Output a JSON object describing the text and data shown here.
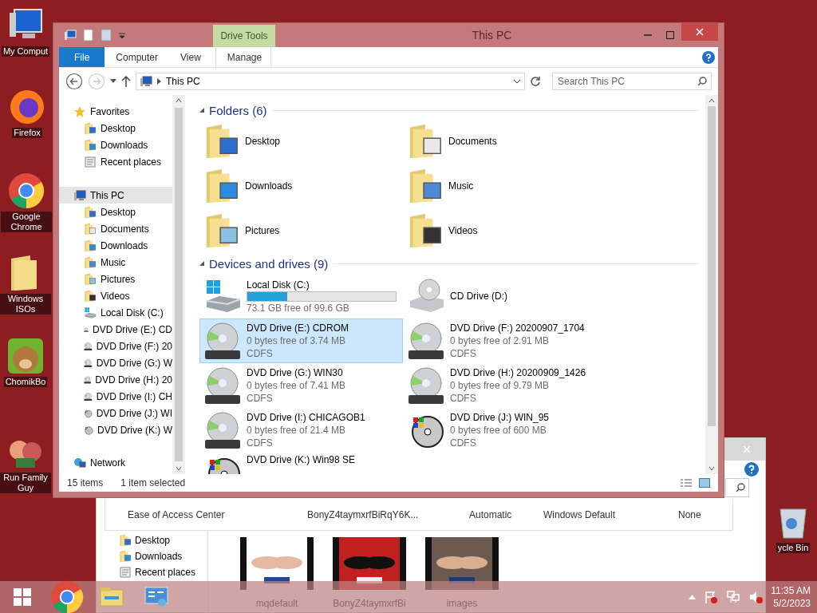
{
  "desktop_icons": [
    {
      "label": "My Comput",
      "kind": "computer"
    },
    {
      "label": "Firefox",
      "kind": "firefox"
    },
    {
      "label": "Google Chrome",
      "kind": "chrome"
    },
    {
      "label": "Windows ISOs",
      "kind": "folder"
    },
    {
      "label": "ChomikBo",
      "kind": "mascot"
    },
    {
      "label": "Run Family Guy",
      "kind": "cartoon"
    },
    {
      "label": "ycle Bin",
      "kind": "bin"
    }
  ],
  "background_window": {
    "row": {
      "name": "Ease of Access Center",
      "cells": [
        "BonyZ4taymxrfBiRqY6K...",
        "Automatic",
        "Windows Default",
        "None"
      ]
    },
    "sidebar": [
      "Desktop",
      "Downloads",
      "Recent places"
    ],
    "thumbnails": [
      {
        "label": "mqdefault",
        "kind": "picture"
      },
      {
        "label": "BonyZ4taymxrfBi",
        "kind": "picture"
      },
      {
        "label": "images",
        "kind": "picture"
      }
    ]
  },
  "explorer": {
    "title": "This PC",
    "context_tab": "Drive Tools",
    "ribbon_tabs": [
      {
        "label": "File",
        "kind": "file"
      },
      {
        "label": "Computer",
        "kind": "tab"
      },
      {
        "label": "View",
        "kind": "tab"
      },
      {
        "label": "Manage",
        "kind": "context"
      }
    ],
    "address": "This PC",
    "search": {
      "placeholder": "Search This PC"
    },
    "nav": [
      {
        "label": "Favorites",
        "kind": "star",
        "selected": false,
        "children": [
          {
            "label": "Desktop",
            "kind": "desktop",
            "selected": false
          },
          {
            "label": "Downloads",
            "kind": "downloads",
            "selected": false
          },
          {
            "label": "Recent places",
            "kind": "recent",
            "selected": false
          }
        ]
      },
      {
        "label": "This PC",
        "kind": "computer",
        "selected": true,
        "children": [
          {
            "label": "Desktop",
            "kind": "desktop",
            "selected": false
          },
          {
            "label": "Documents",
            "kind": "documents",
            "selected": false
          },
          {
            "label": "Downloads",
            "kind": "downloads",
            "selected": false
          },
          {
            "label": "Music",
            "kind": "music",
            "selected": false
          },
          {
            "label": "Pictures",
            "kind": "pictures",
            "selected": false
          },
          {
            "label": "Videos",
            "kind": "videos",
            "selected": false
          },
          {
            "label": "Local Disk (C:)",
            "kind": "hdd",
            "selected": false
          },
          {
            "label": "DVD Drive (E:) CD",
            "kind": "dvd",
            "selected": false
          },
          {
            "label": "DVD Drive (F:) 20",
            "kind": "dvd",
            "selected": false
          },
          {
            "label": "DVD Drive (G:) W",
            "kind": "dvd",
            "selected": false
          },
          {
            "label": "DVD Drive (H:) 20",
            "kind": "dvd",
            "selected": false
          },
          {
            "label": "DVD Drive (I:) CH",
            "kind": "dvd",
            "selected": false
          },
          {
            "label": "DVD Drive (J:) WI",
            "kind": "win",
            "selected": false
          },
          {
            "label": "DVD Drive (K:) W",
            "kind": "win",
            "selected": false
          }
        ]
      },
      {
        "label": "Network",
        "kind": "network",
        "selected": false
      }
    ],
    "folders_header": "Folders (6)",
    "folders": [
      {
        "label": "Desktop",
        "kind": "desktop"
      },
      {
        "label": "Documents",
        "kind": "documents"
      },
      {
        "label": "Downloads",
        "kind": "downloads"
      },
      {
        "label": "Music",
        "kind": "music"
      },
      {
        "label": "Pictures",
        "kind": "pictures"
      },
      {
        "label": "Videos",
        "kind": "videos"
      }
    ],
    "drives_header": "Devices and drives (9)",
    "drives": [
      {
        "name": "Local Disk (C:)",
        "kind": "hdd",
        "level": 0.27,
        "free": "73.1 GB free of 99.6 GB",
        "selected": false
      },
      {
        "name": "CD Drive (D:)",
        "kind": "cd",
        "selected": false
      },
      {
        "name": "DVD Drive (E:) CDROM",
        "kind": "dvd",
        "free": "0 bytes free of 3.74 MB",
        "fs": "CDFS",
        "selected": true
      },
      {
        "name": "DVD Drive (F:) 20200907_1704",
        "kind": "dvd",
        "free": "0 bytes free of 2.91 MB",
        "fs": "CDFS",
        "selected": false
      },
      {
        "name": "DVD Drive (G:) WIN30",
        "kind": "dvd",
        "free": "0 bytes free of 7.41 MB",
        "fs": "CDFS",
        "selected": false
      },
      {
        "name": "DVD Drive (H:) 20200909_1426",
        "kind": "dvd",
        "free": "0 bytes free of 9.79 MB",
        "fs": "CDFS",
        "selected": false
      },
      {
        "name": "DVD Drive (I:) CHICAGOB1",
        "kind": "dvd",
        "free": "0 bytes free of 21.4 MB",
        "fs": "CDFS",
        "selected": false
      },
      {
        "name": "DVD Drive (J:) WIN_95",
        "kind": "win",
        "free": "0 bytes free of 600 MB",
        "fs": "CDFS",
        "selected": false
      },
      {
        "name": "DVD Drive (K:) Win98 SE",
        "kind": "win",
        "selected": false
      }
    ],
    "status": [
      "15 items",
      "1 item selected"
    ]
  },
  "taskbar": {
    "apps": [
      {
        "kind": "chrome"
      },
      {
        "kind": "explorer"
      },
      {
        "kind": "control"
      }
    ],
    "time": "11:35 AM",
    "date": "5/2/2023"
  }
}
